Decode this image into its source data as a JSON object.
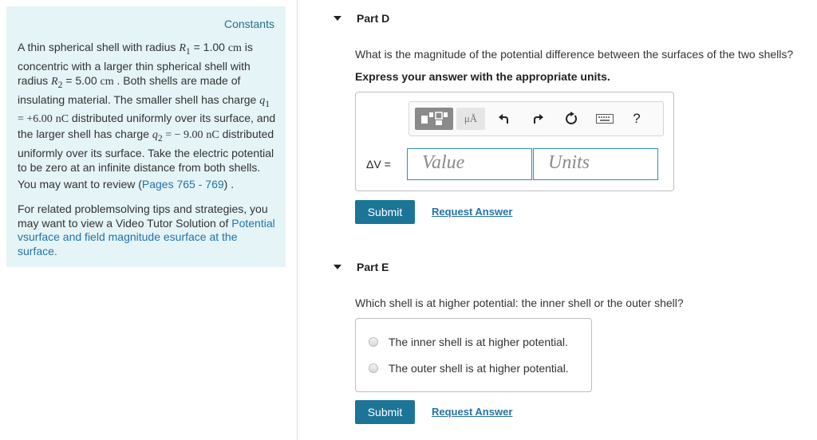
{
  "constants_panel": {
    "title": "Constants",
    "problem_parts": [
      "A thin spherical shell with radius ",
      "R",
      "1",
      " = 1.00",
      "cm",
      " is concentric with a larger thin spherical shell with radius ",
      "R",
      "2",
      " = 5.00",
      "cm",
      " . Both shells are made of insulating material. The smaller shell has charge ",
      "q",
      "1",
      " = +6.00",
      "nC",
      " distributed uniformly over its surface, and the larger shell has charge ",
      "q",
      "2",
      " = − 9.00",
      "nC",
      " distributed uniformly over its surface. Take the electric potential to be zero at an infinite distance from both shells."
    ],
    "review_prefix": "You may want to review (",
    "review_link": "Pages 765 - 769",
    "review_suffix": ") .",
    "tips_text": "For related problemsolving tips and strategies, you may want to view a Video Tutor Solution of ",
    "tips_link": "Potential vsurface and field magnitude esurface at the surface."
  },
  "part_d": {
    "title": "Part D",
    "question": "What is the magnitude of the potential difference between the surfaces of the two shells?",
    "instruction": "Express your answer with the appropriate units.",
    "toolbar": {
      "units_label": "μÅ",
      "help_label": "?"
    },
    "variable_label": "ΔV =",
    "value_placeholder": "Value",
    "units_placeholder": "Units",
    "submit_label": "Submit",
    "request_label": "Request Answer"
  },
  "part_e": {
    "title": "Part E",
    "question": "Which shell is at higher potential: the inner shell or the outer shell?",
    "options": [
      "The inner shell is at higher potential.",
      "The outer shell is at higher potential."
    ],
    "submit_label": "Submit",
    "request_label": "Request Answer"
  }
}
